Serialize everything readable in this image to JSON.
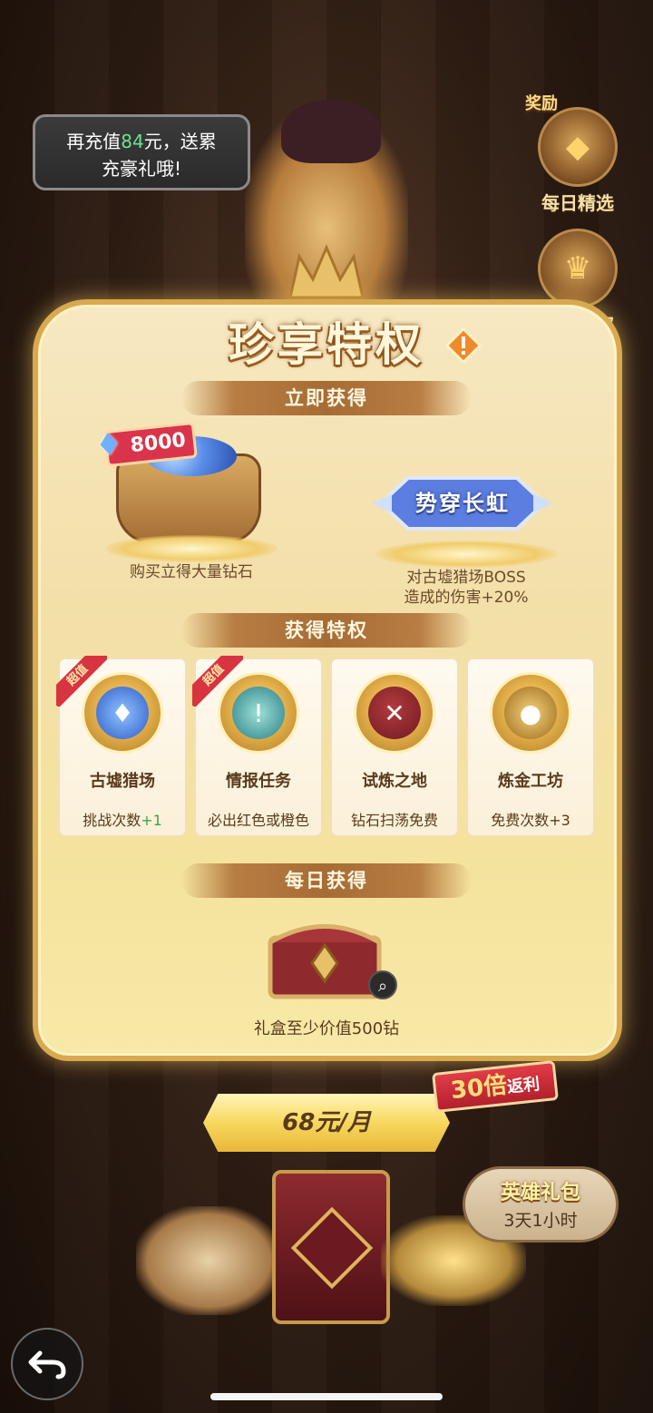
{
  "bubble": {
    "pre": "再充值",
    "amount": "84",
    "post": "元，送累",
    "line2": "充豪礼哦!"
  },
  "side": {
    "daily_pick": {
      "tag": "奖励",
      "label": "每日精选"
    },
    "privilege": {
      "label": "珍享特权"
    }
  },
  "panel": {
    "title": "珍享特权",
    "section_instant": "立即获得",
    "section_privilege": "获得特权",
    "section_daily": "每日获得"
  },
  "instant": {
    "diamond_amount": "8000",
    "diamond_desc": "购买立得大量钻石",
    "buff_name": "势穿长虹",
    "buff_desc_line1": "对古墟猎场BOSS",
    "buff_desc_line2": "造成的伤害+20%"
  },
  "privileges": [
    {
      "ribbon": "超值",
      "name": "古墟猎场",
      "desc": "挑战次数",
      "bonus": "+1",
      "icon": "diamond-icon"
    },
    {
      "ribbon": "超值",
      "name": "情报任务",
      "desc": "必出红色或橙色",
      "bonus": "",
      "icon": "intel-card-icon"
    },
    {
      "ribbon": "",
      "name": "试炼之地",
      "desc": "钻石扫荡免费",
      "bonus": "",
      "icon": "crossed-swords-icon"
    },
    {
      "ribbon": "",
      "name": "炼金工坊",
      "desc": "免费次数+3",
      "bonus": "",
      "icon": "gold-bag-icon"
    }
  ],
  "daily": {
    "desc": "礼盒至少价值500钻"
  },
  "purchase": {
    "price": "68元/月",
    "rebate_big": "30倍",
    "rebate_small": "返利"
  },
  "hero_pack": {
    "title": "英雄礼包",
    "time": "3天1小时"
  },
  "colors": {
    "accent_gold": "#e8b73a",
    "ribbon_red": "#d8343f",
    "bonus_green": "#3aa84a"
  }
}
